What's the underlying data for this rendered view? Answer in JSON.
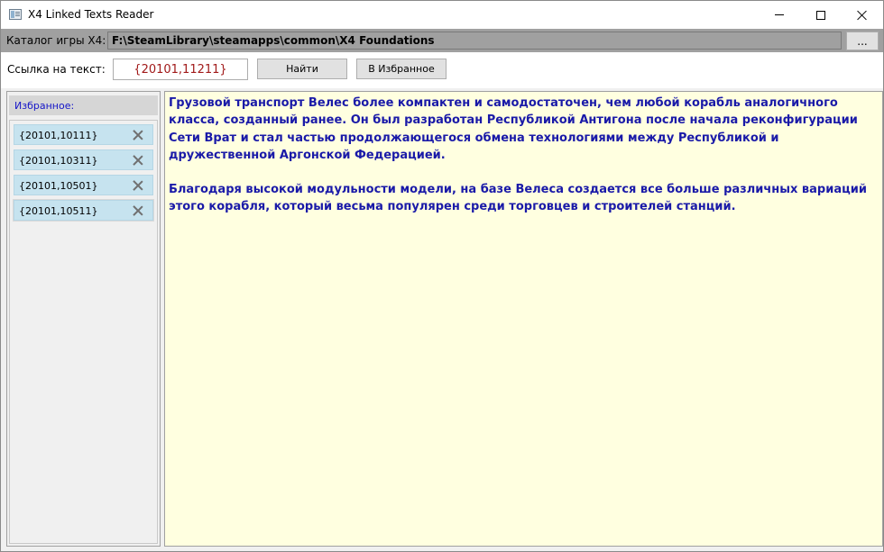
{
  "window": {
    "title": "X4 Linked Texts Reader"
  },
  "directory": {
    "label": "Каталог игры X4:",
    "path": "F:\\SteamLibrary\\steamapps\\common\\X4 Foundations",
    "browse_label": "..."
  },
  "reference": {
    "label": "Ссылка на текст:",
    "value": "{20101,11211}",
    "find_label": "Найти",
    "add_favorite_label": "В Избранное"
  },
  "favorites": {
    "header": "Избранное:",
    "items": [
      {
        "label": "{20101,10111}"
      },
      {
        "label": "{20101,10311}"
      },
      {
        "label": "{20101,10501}"
      },
      {
        "label": "{20101,10511}"
      }
    ]
  },
  "text": {
    "paragraphs": [
      "Грузовой транспорт Велес более компактен и самодостаточен, чем любой корабль аналогичного класса, созданный ранее. Он был разработан Республикой Антигона после начала реконфигурации Сети Врат и стал частью продолжающегося обмена технологиями между Республикой и дружественной Аргонской Федерацией.",
      "Благодаря высокой модульности модели, на базе Велеса создается все больше различных вариаций этого корабля, который весьма популярен среди торговцев и строителей станций."
    ]
  },
  "colors": {
    "favorite_header_text": "#1515c8",
    "reference_value": "#a11a1a",
    "body_text": "#1a1aa8",
    "text_background": "#ffffe0",
    "favorite_item_bg": "#c6e3ef"
  }
}
